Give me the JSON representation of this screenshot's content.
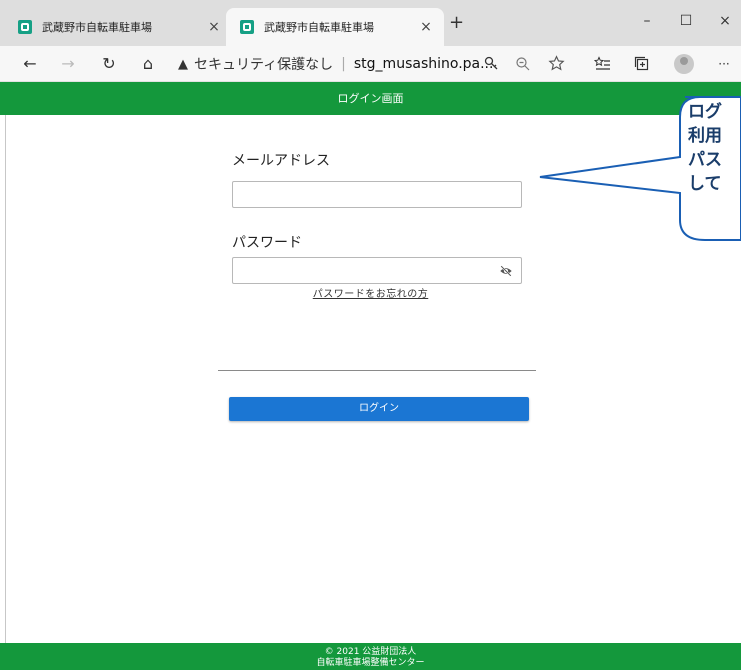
{
  "browser": {
    "tabs": [
      {
        "title": "武蔵野市自転車駐車場",
        "close": "×"
      },
      {
        "title": "武蔵野市自転車駐車場",
        "close": "×"
      }
    ],
    "new_tab": "+",
    "window_controls": {
      "minimize": "–",
      "maximize": "☐",
      "close": "×"
    },
    "nav": {
      "back": "←",
      "forward": "→",
      "reload": "↻",
      "home": "⌂"
    },
    "address": {
      "warning_icon": "▲",
      "security_text": "セキュリティ保護なし",
      "separator": "|",
      "url": "stg_musashino.pa..."
    },
    "toolbar_icons": [
      "read-aloud-icon",
      "zoom-icon",
      "favorite-icon",
      "favorites-list-icon",
      "collections-icon",
      "profile-icon",
      "more-icon"
    ],
    "more": "···"
  },
  "page": {
    "header_title": "ログイン画面",
    "email_label": "メールアドレス",
    "email_value": "",
    "password_label": "パスワード",
    "password_value": "",
    "forgot_link": "パスワードをお忘れの方",
    "login_button": "ログイン",
    "footer_line1": "© 2021 公益財団法人",
    "footer_line2": "自転車駐車場整備センター"
  },
  "callout": {
    "lines": [
      "ログ",
      "利用",
      "パス",
      "して"
    ]
  },
  "colors": {
    "header_green": "#14983c",
    "button_blue": "#1b76d3",
    "callout_border": "#1a5fb4",
    "callout_text": "#1a3d6a"
  }
}
